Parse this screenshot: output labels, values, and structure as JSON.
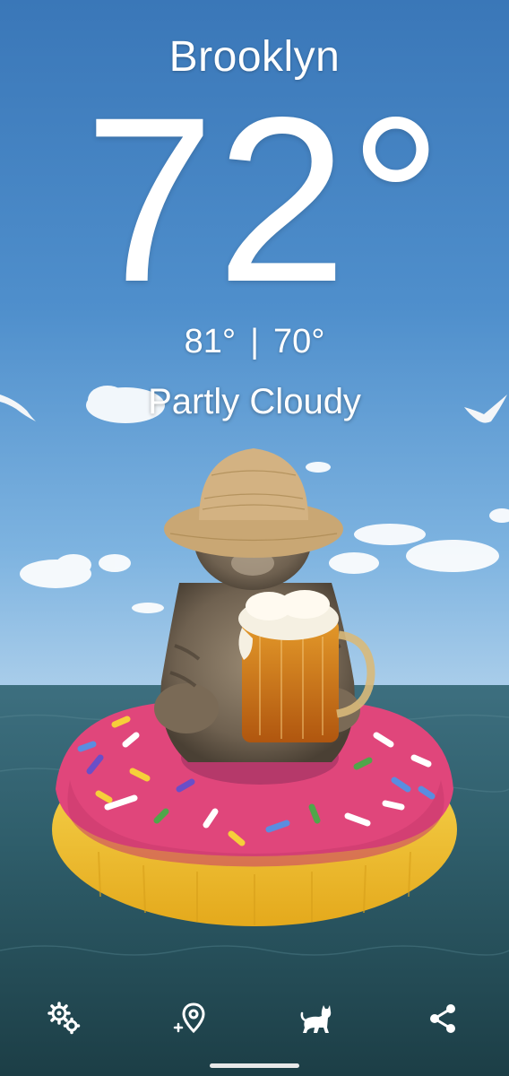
{
  "location": {
    "city": "Brooklyn"
  },
  "weather": {
    "temperature": "72°",
    "high": "81°",
    "separator": "|",
    "low": "70°",
    "condition": "Partly Cloudy"
  },
  "toolbar": {
    "items": [
      {
        "icon": "settings-gears-icon"
      },
      {
        "icon": "add-location-icon"
      },
      {
        "icon": "cat-icon"
      },
      {
        "icon": "share-icon"
      }
    ]
  },
  "colors": {
    "sky_top": "#3f7fbf",
    "sky_bottom": "#7fb3de",
    "sea": "#2d5a66",
    "text": "#ffffff",
    "float_pink": "#e0467b",
    "float_yellow": "#f6cf3a"
  }
}
